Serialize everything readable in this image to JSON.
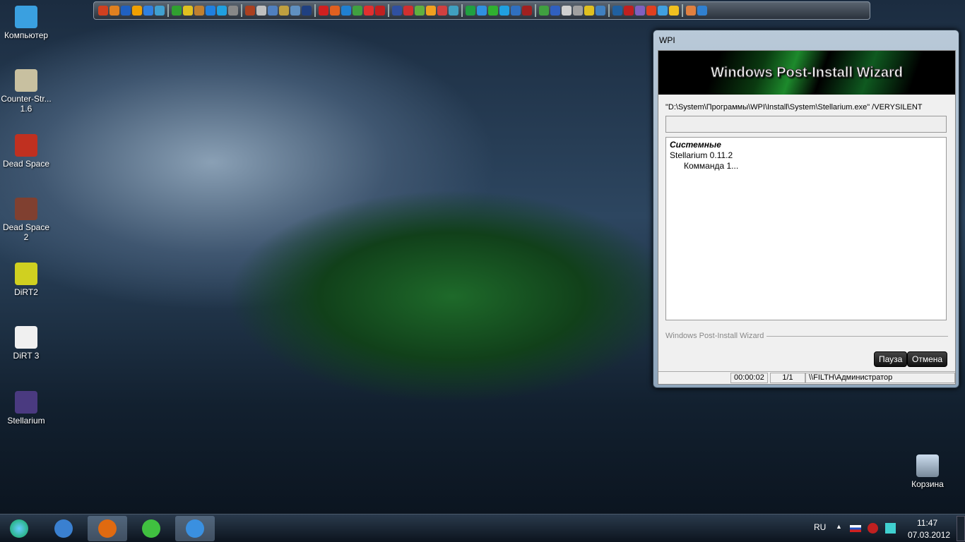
{
  "desktop": {
    "icons": [
      {
        "label": "Компьютер",
        "color": "#3aa0e0"
      },
      {
        "label": "Counter-Str... 1.6",
        "color": "#c8c0a0"
      },
      {
        "label": "Dead Space",
        "color": "#c03020"
      },
      {
        "label": "Dead Space 2",
        "color": "#804030"
      },
      {
        "label": "DiRT2",
        "color": "#d0d020"
      },
      {
        "label": "DiRT 3",
        "color": "#f0f0f0"
      },
      {
        "label": "Stellarium",
        "color": "#4a3a80"
      }
    ],
    "recycle_bin": "Корзина"
  },
  "quick_toolbar": {
    "icon_colors": [
      "#d04020",
      "#e08020",
      "#2060c0",
      "#f0a000",
      "#3080e0",
      "#40a0d0",
      "#30a030",
      "#e0c020",
      "#c08030",
      "#2080e0",
      "#20a0e0",
      "#888888",
      "#aa4020",
      "#c0c0c0",
      "#5080c0",
      "#c0a040",
      "#6090c0",
      "#204080",
      "#d02020",
      "#e06020",
      "#2080d0",
      "#40a040",
      "#e03030",
      "#c02020",
      "#3050a0",
      "#d03030",
      "#60b040",
      "#f0a020",
      "#d04040",
      "#40a0c0",
      "#20a040",
      "#3090e0",
      "#30b030",
      "#20a0e0",
      "#3070c0",
      "#a02020",
      "#40a040",
      "#3060c0",
      "#d0d0d0",
      "#a0a0a0",
      "#e0c020",
      "#4080c0",
      "#2060a0",
      "#c02020",
      "#8060c0",
      "#e04020",
      "#40a0e0",
      "#f0c020",
      "#e08040",
      "#3080d0"
    ]
  },
  "wpi": {
    "title": "WPI",
    "banner": "Windows Post-Install Wizard",
    "command": "\"D:\\System\\Программы\\WPI\\Install\\System\\Stellarium.exe\" /VERYSILENT",
    "progress": 0,
    "log": {
      "category": "Системные",
      "program": "Stellarium 0.11.2",
      "step": "Комманда 1..."
    },
    "group_label": "Windows Post-Install Wizard",
    "pause_label": "Пауза",
    "cancel_label": "Отмена",
    "status": {
      "elapsed": "00:00:02",
      "count": "1/1",
      "user": "\\\\FILTH\\Администратор"
    }
  },
  "taskbar": {
    "items": [
      {
        "name": "thunderbird",
        "color": "#3a80d0"
      },
      {
        "name": "firefox",
        "color": "#e06a10"
      },
      {
        "name": "green-app",
        "color": "#40c040"
      },
      {
        "name": "wpi",
        "color": "#3a90e0"
      }
    ],
    "language": "RU",
    "time": "11:47",
    "date": "07.03.2012"
  }
}
